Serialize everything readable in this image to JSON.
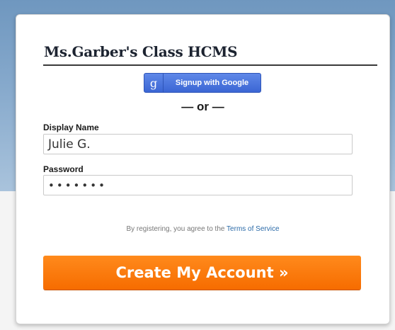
{
  "form": {
    "title": "Ms.Garber's Class HCMS",
    "google_button": {
      "icon": "g",
      "label": "Signup with Google"
    },
    "divider_text": "— or —",
    "display_name": {
      "label": "Display Name",
      "value": "Julie G."
    },
    "password": {
      "label": "Password",
      "value": "•••••••"
    },
    "terms": {
      "prefix": "By registering, you agree to the ",
      "link": "Terms of Service"
    },
    "submit_label": "Create My Account »"
  },
  "colors": {
    "accent_orange": "#f97a10",
    "google_blue": "#4a74de",
    "background_blue": "#7ca1c6",
    "link_blue": "#2a6aa8"
  }
}
